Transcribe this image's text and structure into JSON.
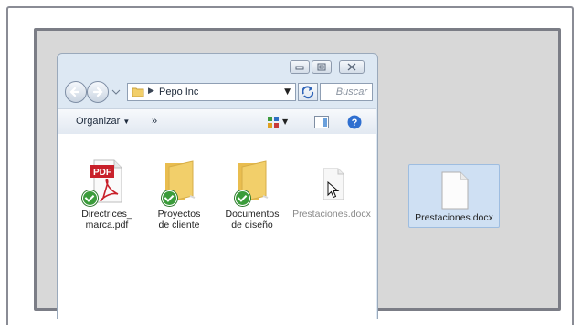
{
  "window": {
    "breadcrumb_root": "Pepo Inc",
    "search_placeholder": "Buscar"
  },
  "toolbar": {
    "organize_label": "Organizar",
    "more_label": "»"
  },
  "files": [
    {
      "name_line1": "Directrices_",
      "name_line2": "marca.pdf",
      "icon": "pdf-icon",
      "synced": true
    },
    {
      "name_line1": "Proyectos",
      "name_line2": "de cliente",
      "icon": "folder-icon",
      "synced": true
    },
    {
      "name_line1": "Documentos",
      "name_line2": "de diseño",
      "icon": "folder-icon",
      "synced": true
    },
    {
      "name_line1": "Prestaciones.docx",
      "icon": "document-icon",
      "synced": false
    }
  ],
  "desktop_file": {
    "name": "Prestaciones.docx",
    "icon": "document-icon"
  },
  "colors": {
    "sync_check": "#3a9c3a",
    "selection": "#cfe0f3",
    "folder": "#f2cf6a",
    "pdf_red": "#c8202a"
  }
}
